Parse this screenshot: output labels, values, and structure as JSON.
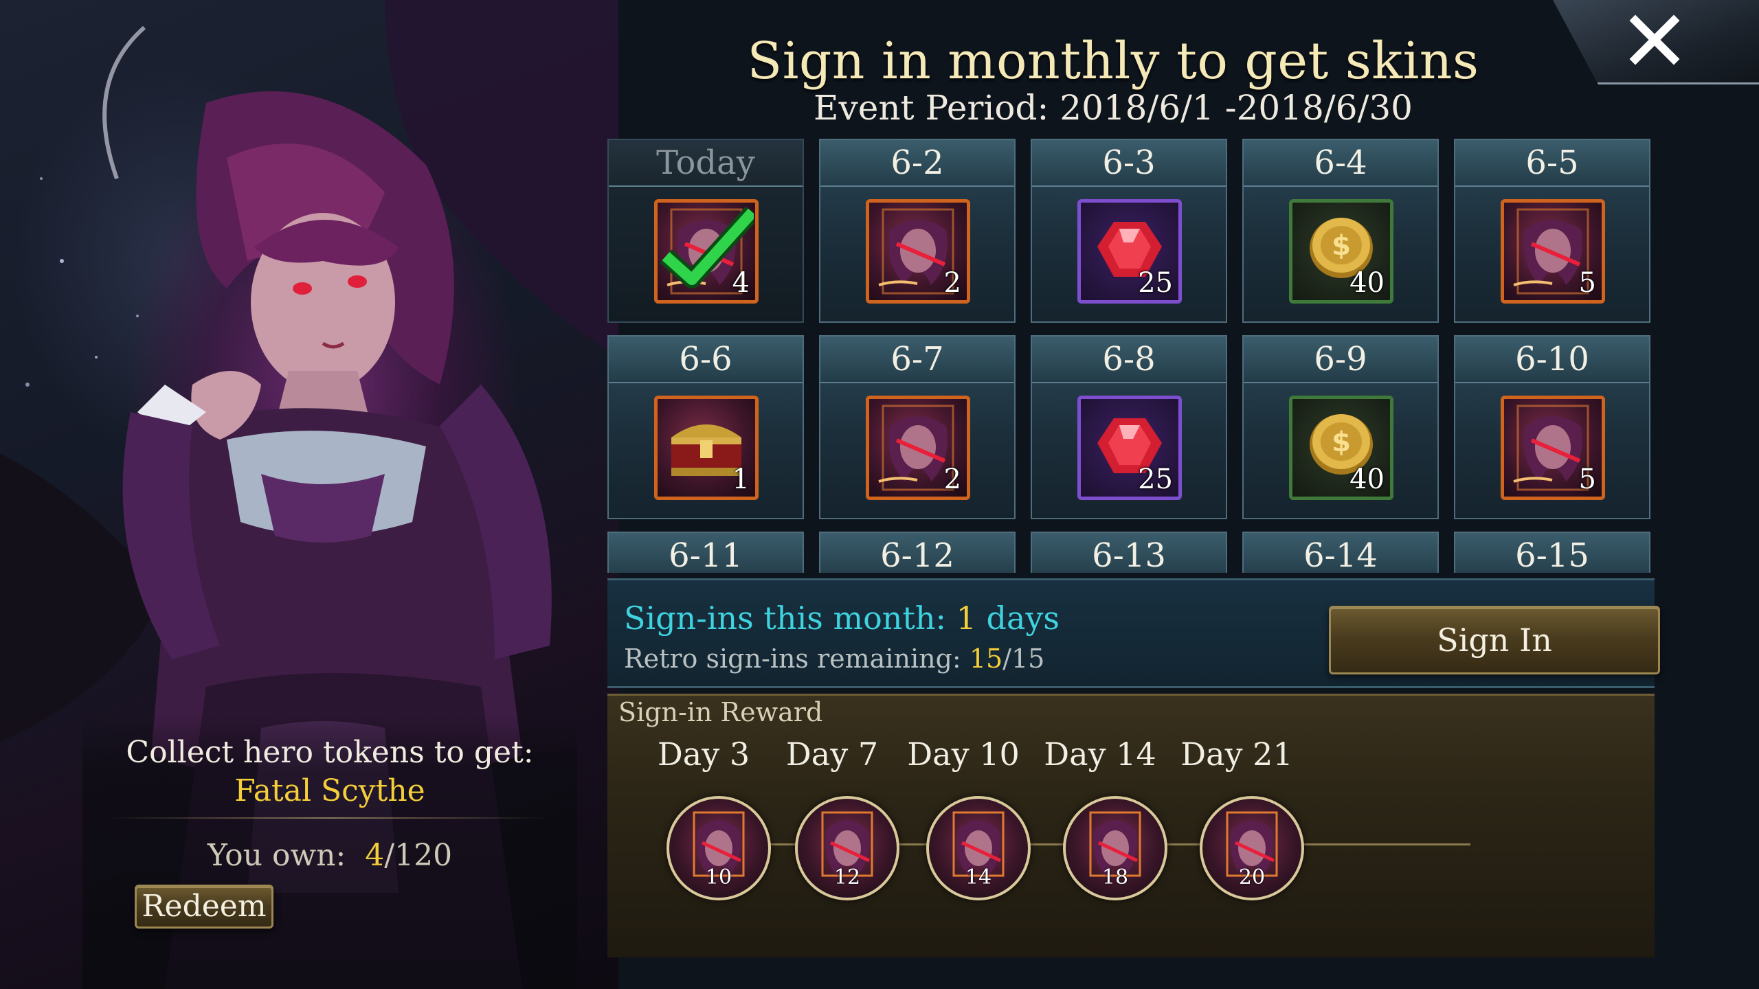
{
  "header": {
    "title": "Sign in monthly to get skins",
    "event_period": "Event Period: 2018/6/1 -2018/6/30"
  },
  "hero_panel": {
    "collect_title": "Collect hero tokens to get:",
    "skin_name": "Fatal Scythe",
    "own_label": "You own:",
    "own_value": "4",
    "own_total": "/120",
    "redeem_label": "Redeem"
  },
  "calendar": {
    "days": [
      {
        "label": "Today",
        "reward": "hero-token",
        "count": "4",
        "claimed": true
      },
      {
        "label": "6-2",
        "reward": "hero-token",
        "count": "2"
      },
      {
        "label": "6-3",
        "reward": "ruby",
        "count": "25"
      },
      {
        "label": "6-4",
        "reward": "gold-coin",
        "count": "40"
      },
      {
        "label": "6-5",
        "reward": "hero-token",
        "count": "5"
      },
      {
        "label": "6-6",
        "reward": "treasure-chest",
        "count": "1"
      },
      {
        "label": "6-7",
        "reward": "hero-token",
        "count": "2"
      },
      {
        "label": "6-8",
        "reward": "ruby",
        "count": "25"
      },
      {
        "label": "6-9",
        "reward": "gold-coin",
        "count": "40"
      },
      {
        "label": "6-10",
        "reward": "hero-token",
        "count": "5"
      },
      {
        "label": "6-11"
      },
      {
        "label": "6-12"
      },
      {
        "label": "6-13"
      },
      {
        "label": "6-14"
      },
      {
        "label": "6-15"
      }
    ]
  },
  "signin": {
    "signins_label": "Sign-ins this month:",
    "signins_count": "1",
    "signins_unit": "days",
    "retro_label": "Retro sign-ins remaining:",
    "retro_remaining": "15",
    "retro_total": "/15",
    "button_label": "Sign In"
  },
  "reward_track": {
    "title": "Sign-in Reward",
    "milestones": [
      {
        "day": "Day 3",
        "count": "10"
      },
      {
        "day": "Day 7",
        "count": "12"
      },
      {
        "day": "Day 10",
        "count": "14"
      },
      {
        "day": "Day 14",
        "count": "18"
      },
      {
        "day": "Day 21",
        "count": "20"
      }
    ]
  },
  "colors": {
    "accent_gold": "#f4cf3a",
    "accent_cyan": "#3fd3e0",
    "frame_orange": "#d0641e",
    "frame_purple": "#7d4fcf",
    "frame_green": "#3f7a3a",
    "check_green": "#2fd44a"
  }
}
